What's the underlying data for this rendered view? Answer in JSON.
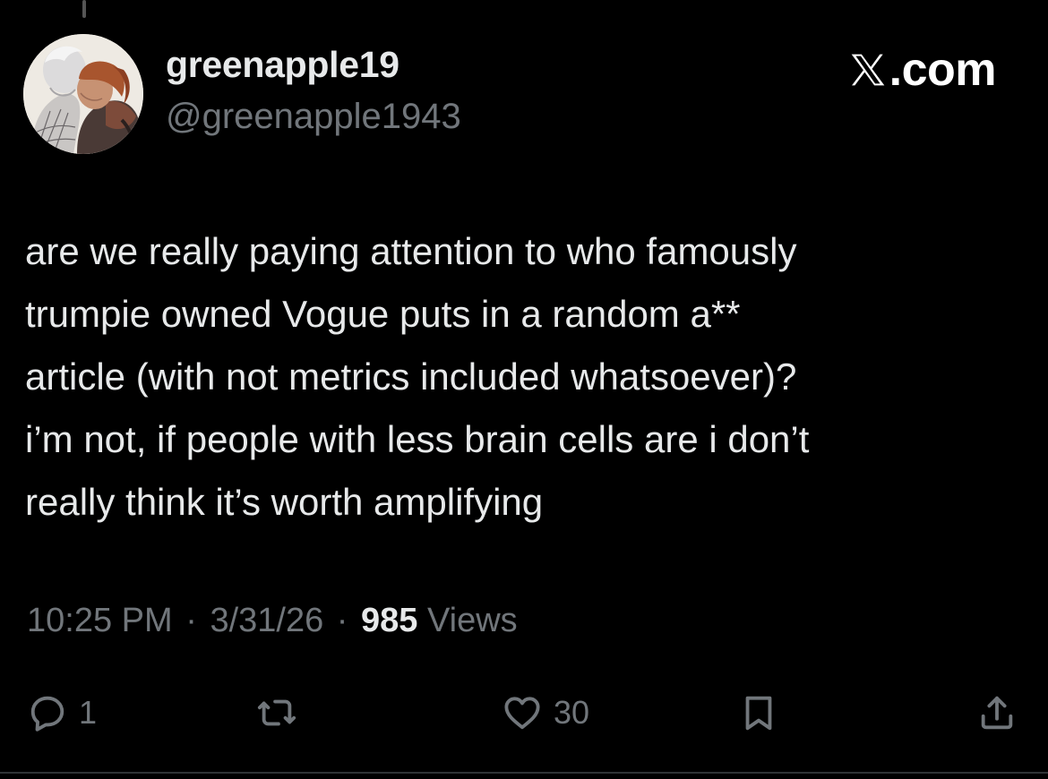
{
  "author": {
    "display_name": "greenapple19",
    "handle": "@greenapple1943"
  },
  "brand": {
    "label": ".com",
    "icon": "x-logo-icon"
  },
  "tweet": {
    "lines": [
      "are we really paying attention to who famously",
      "trumpie owned Vogue puts in a random a**",
      "article (with not metrics included whatsoever)?",
      "i’m not, if people with less brain cells are i don’t",
      "really think it’s worth amplifying"
    ]
  },
  "meta": {
    "time": "10:25 PM",
    "separator": "·",
    "date": "3/31/26",
    "views_count": "985",
    "views_label": "Views"
  },
  "actions": {
    "reply": {
      "icon": "reply-icon",
      "count": "1"
    },
    "retweet": {
      "icon": "retweet-icon",
      "count": ""
    },
    "like": {
      "icon": "heart-icon",
      "count": "30"
    },
    "bookmark": {
      "icon": "bookmark-icon"
    },
    "share": {
      "icon": "share-icon"
    }
  },
  "colors": {
    "background": "#000000",
    "text_primary": "#e7e9ea",
    "text_secondary": "#71767b"
  }
}
